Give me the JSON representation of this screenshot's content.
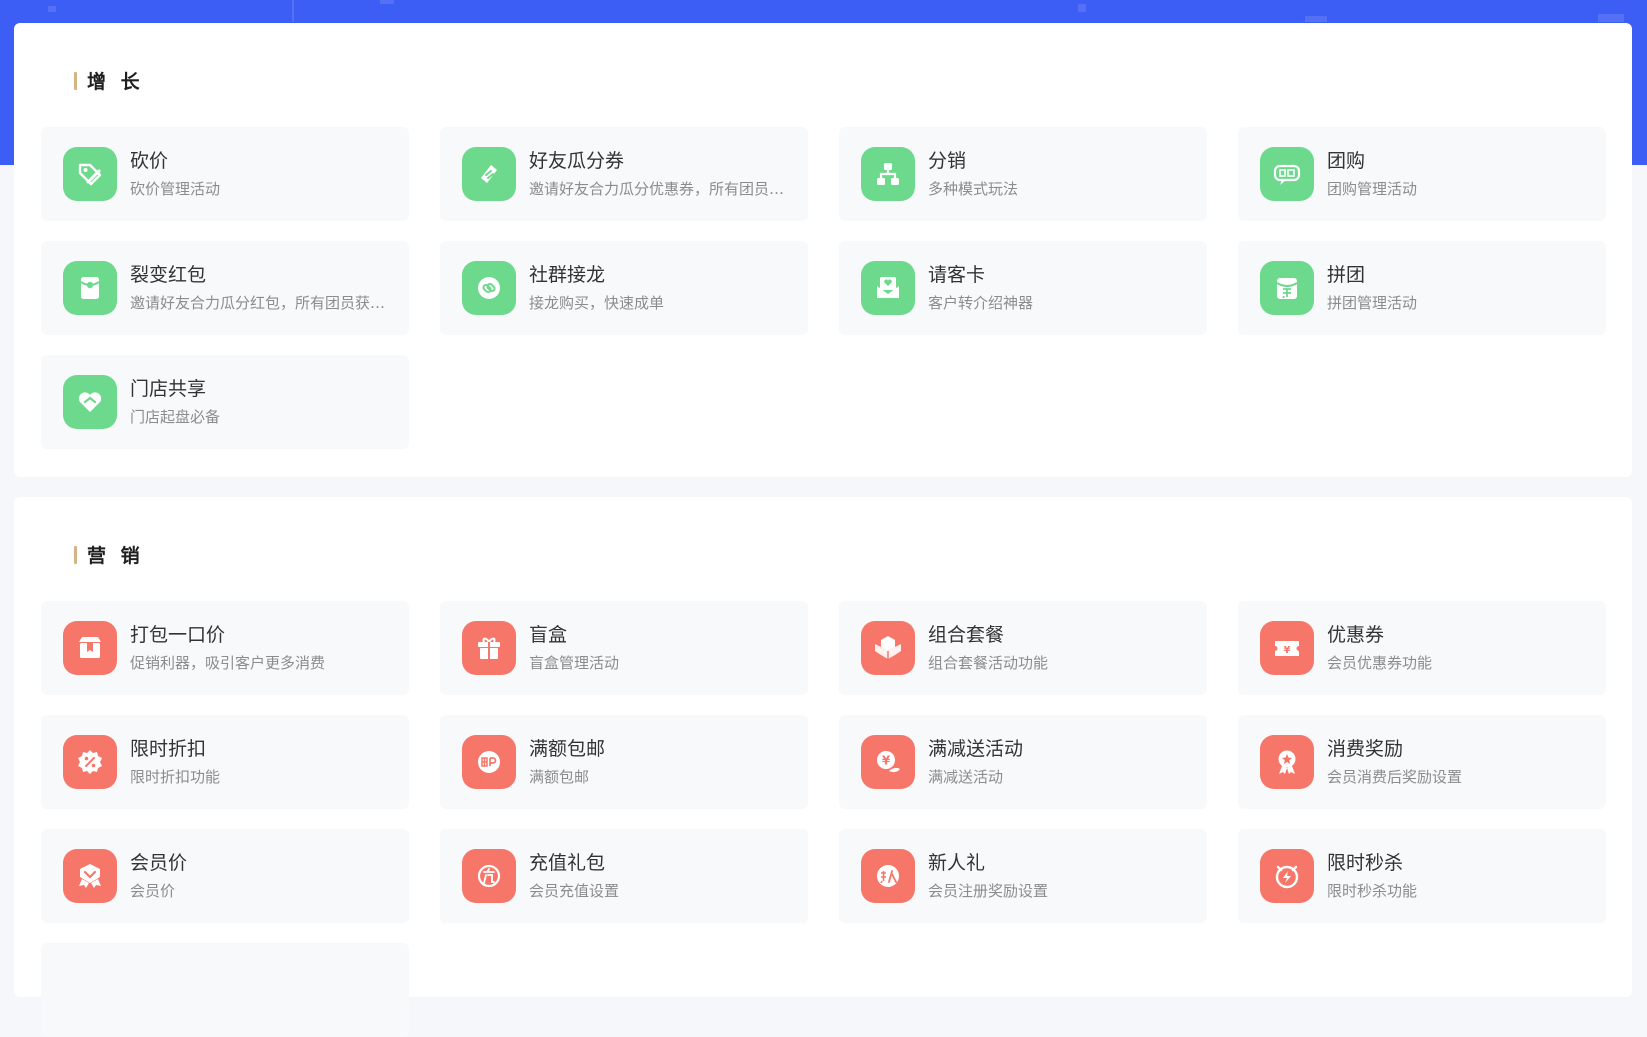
{
  "colors": {
    "brand_blue": "#3d5ef5",
    "growth_icon": "#6dd98c",
    "marketing_icon": "#f6766a",
    "title_bar": "#d4b483"
  },
  "sections": [
    {
      "title": "增 长",
      "items": [
        {
          "title": "砍价",
          "desc": "砍价管理活动",
          "icon": "tag-icon"
        },
        {
          "title": "好友瓜分券",
          "desc": "邀请好友合力瓜分优惠券，所有团员…",
          "icon": "coupon-split-icon"
        },
        {
          "title": "分销",
          "desc": "多种模式玩法",
          "icon": "distribution-icon"
        },
        {
          "title": "团购",
          "desc": "团购管理活动",
          "icon": "group-buy-icon"
        },
        {
          "title": "裂变红包",
          "desc": "邀请好友合力瓜分红包，所有团员获…",
          "icon": "red-envelope-icon"
        },
        {
          "title": "社群接龙",
          "desc": "接龙购买，快速成单",
          "icon": "chain-link-icon"
        },
        {
          "title": "请客卡",
          "desc": "客户转介绍神器",
          "icon": "invite-card-icon"
        },
        {
          "title": "拼团",
          "desc": "拼团管理活动",
          "icon": "team-buy-icon"
        },
        {
          "title": "门店共享",
          "desc": "门店起盘必备",
          "icon": "heart-share-icon"
        }
      ]
    },
    {
      "title": "营 销",
      "items": [
        {
          "title": "打包一口价",
          "desc": "促销利器，吸引客户更多消费",
          "icon": "bundle-box-icon"
        },
        {
          "title": "盲盒",
          "desc": "盲盒管理活动",
          "icon": "gift-box-icon"
        },
        {
          "title": "组合套餐",
          "desc": "组合套餐活动功能",
          "icon": "combo-cube-icon"
        },
        {
          "title": "优惠券",
          "desc": "会员优惠券功能",
          "icon": "coupon-icon"
        },
        {
          "title": "限时折扣",
          "desc": "限时折扣功能",
          "icon": "discount-badge-icon"
        },
        {
          "title": "满额包邮",
          "desc": "满额包邮",
          "icon": "free-shipping-icon"
        },
        {
          "title": "满减送活动",
          "desc": "满减送活动",
          "icon": "yen-reduction-icon"
        },
        {
          "title": "消费奖励",
          "desc": "会员消费后奖励设置",
          "icon": "reward-medal-icon"
        },
        {
          "title": "会员价",
          "desc": "会员价",
          "icon": "member-price-icon"
        },
        {
          "title": "充值礼包",
          "desc": "会员充值设置",
          "icon": "recharge-icon"
        },
        {
          "title": "新人礼",
          "desc": "会员注册奖励设置",
          "icon": "newcomer-icon"
        },
        {
          "title": "限时秒杀",
          "desc": "限时秒杀功能",
          "icon": "flash-sale-icon"
        }
      ]
    }
  ]
}
